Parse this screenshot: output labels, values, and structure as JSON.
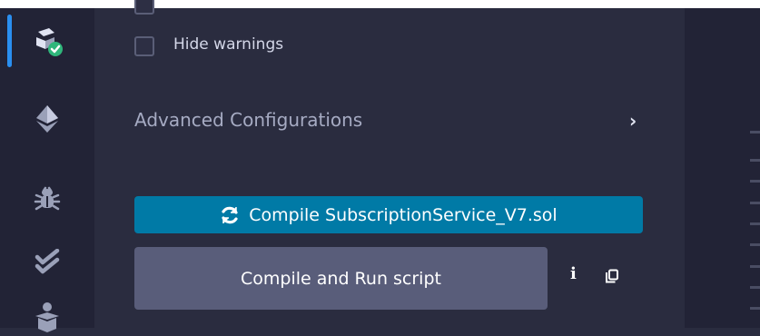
{
  "sidebar": {
    "icons": [
      {
        "name": "solidity-compiler-icon",
        "active": true
      },
      {
        "name": "ethereum-icon",
        "active": false
      },
      {
        "name": "debugger-icon",
        "active": false
      },
      {
        "name": "unit-testing-icon",
        "active": false
      },
      {
        "name": "learneth-icon",
        "active": false
      }
    ]
  },
  "options": {
    "hide_warnings_label": "Hide warnings",
    "hide_warnings_checked": false
  },
  "advanced": {
    "title": "Advanced Configurations",
    "chevron": "›"
  },
  "compile_button": {
    "icon": "refresh-icon",
    "label": "Compile SubscriptionService_V7.sol"
  },
  "run_button": {
    "label": "Compile and Run script"
  },
  "aux_icons": {
    "info": "i",
    "copy": "copy-icon"
  },
  "colors": {
    "accent": "#007aa6",
    "rail_active_indicator": "#2a8ff0",
    "status_badge": "#2fb67b",
    "secondary_button": "#595d7a"
  }
}
